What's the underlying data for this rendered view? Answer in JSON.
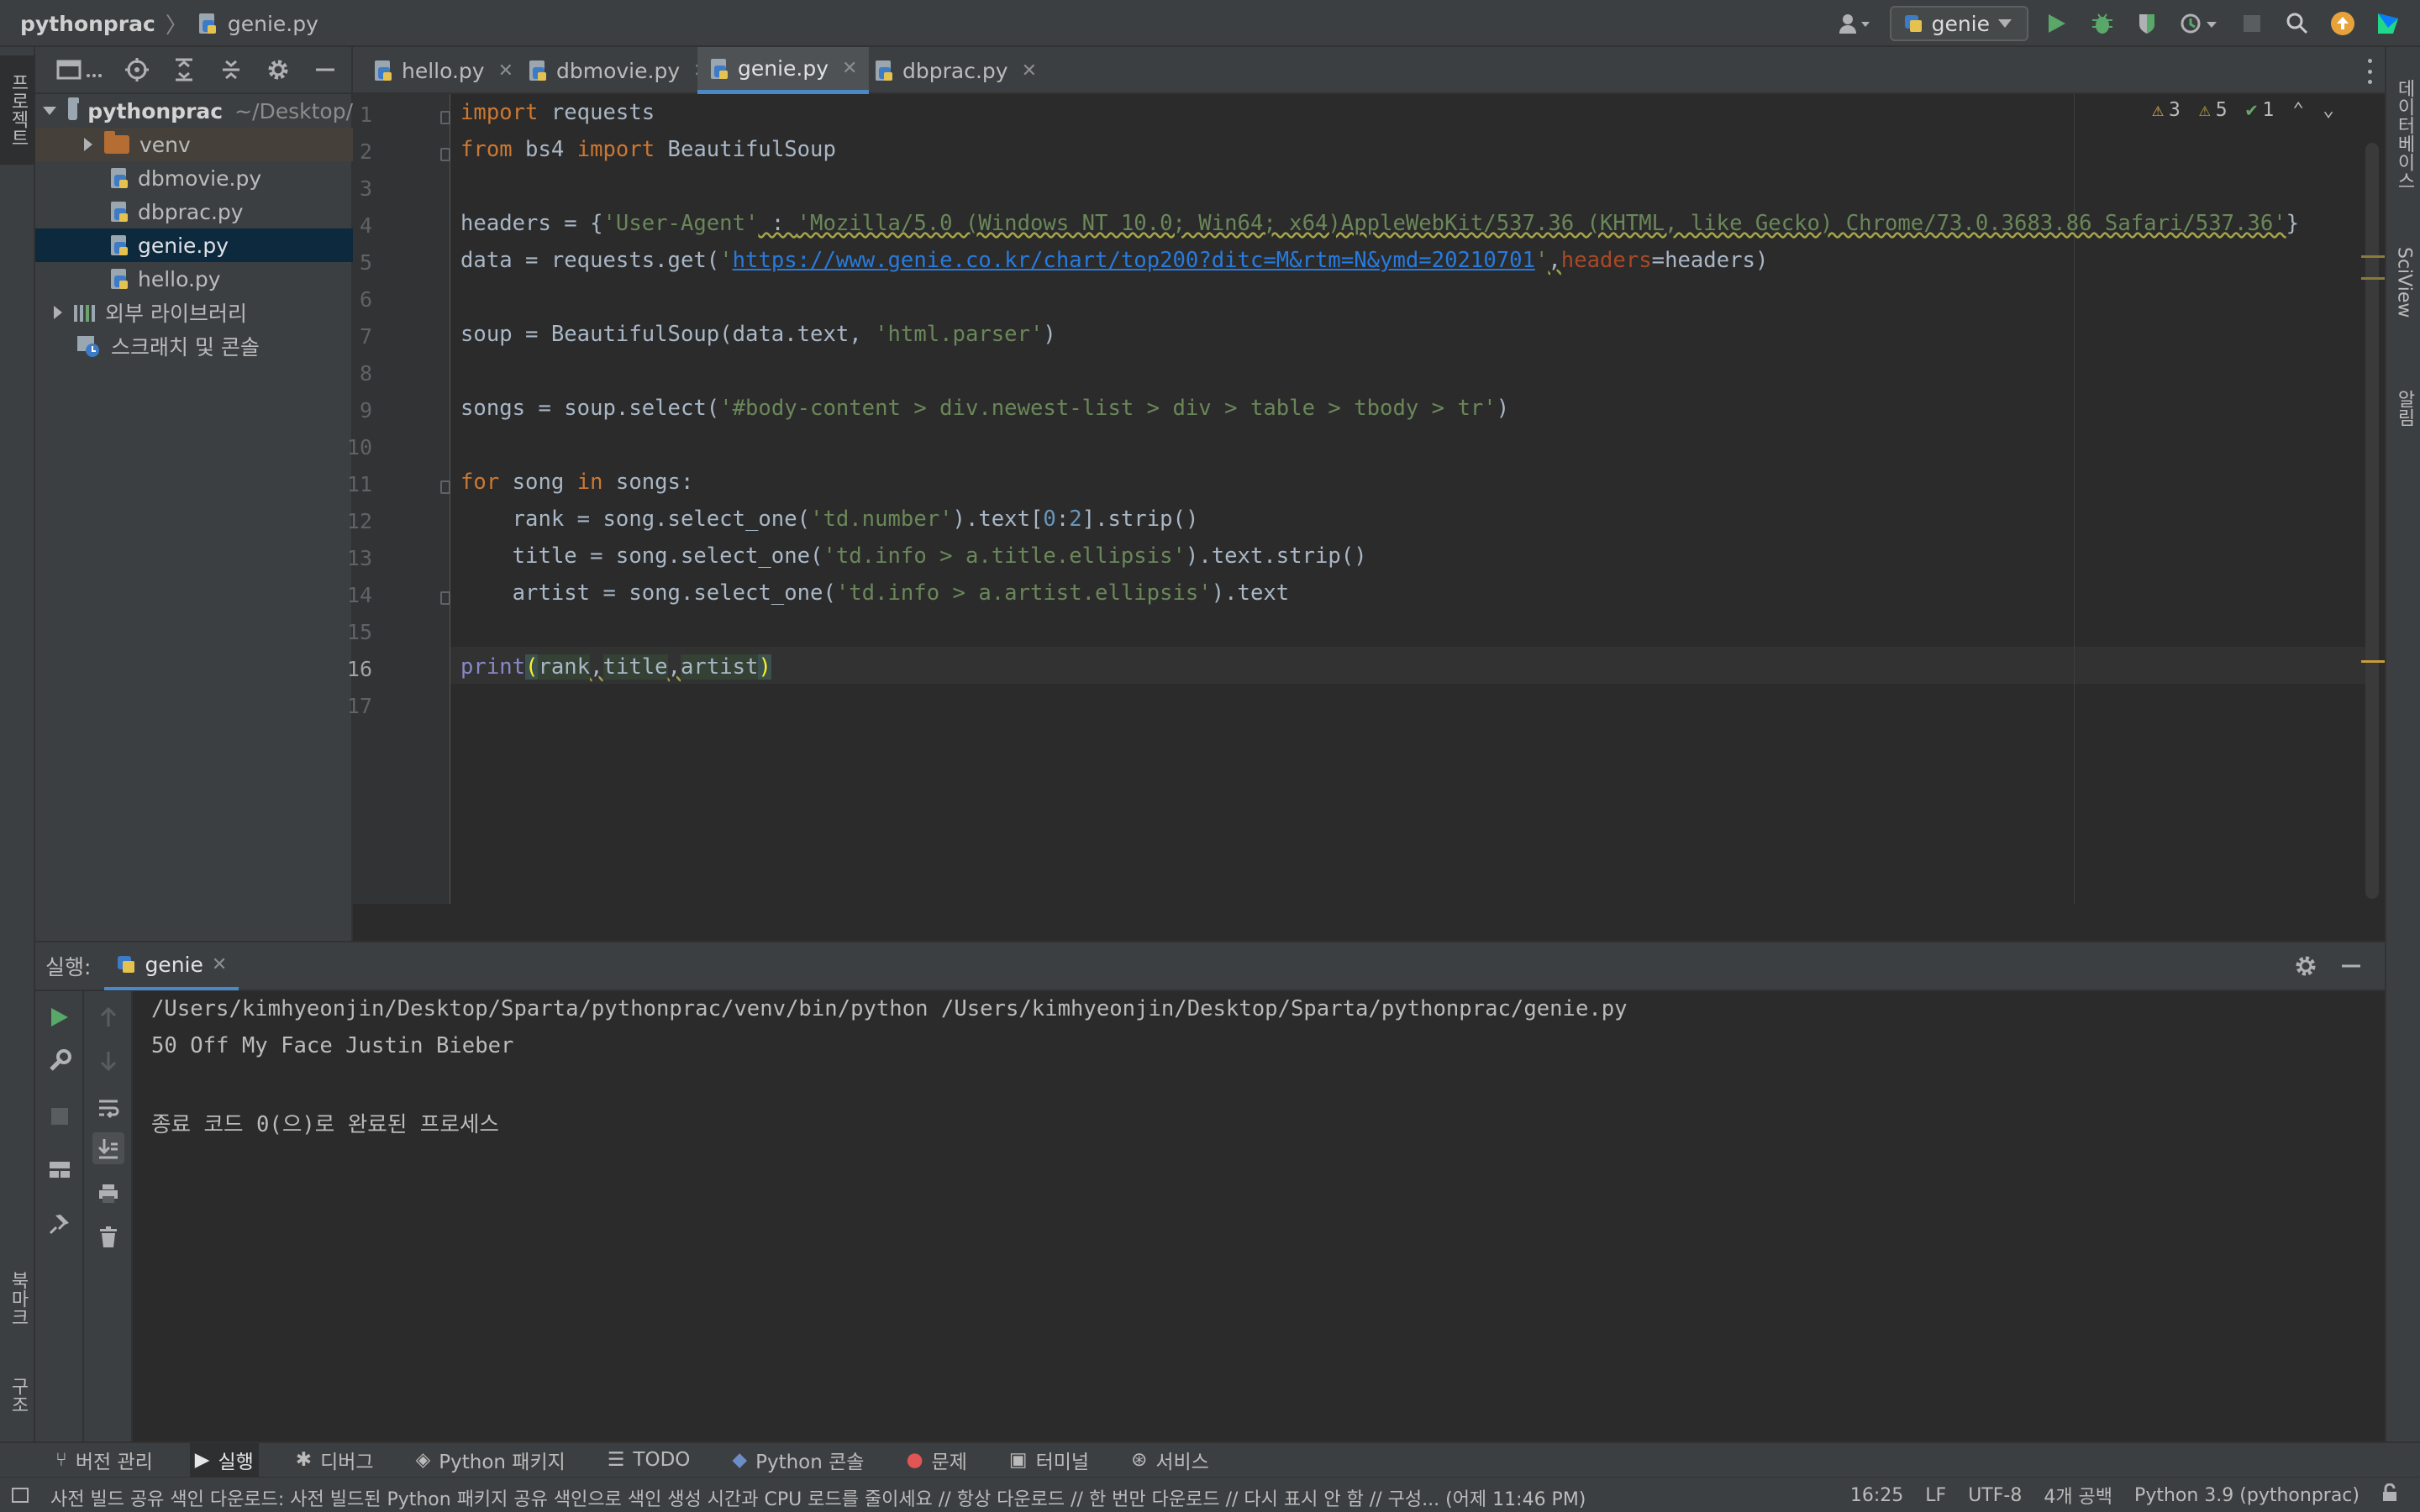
{
  "titlebar": {
    "project": "pythonprac",
    "file": "genie.py",
    "run_config": "genie"
  },
  "left_strip": {
    "project_tab": "프로젝트",
    "bookmarks_tab": "북마크",
    "structure_tab": "구조"
  },
  "right_strip": {
    "database_tab": "데이터베이스",
    "sciview_tab": "SciView",
    "notifications_tab": "알림"
  },
  "project_tree": {
    "root_name": "pythonprac",
    "root_path": "~/Desktop/",
    "items": [
      {
        "label": "venv"
      },
      {
        "label": "dbmovie.py"
      },
      {
        "label": "dbprac.py"
      },
      {
        "label": "genie.py"
      },
      {
        "label": "hello.py"
      },
      {
        "label": "외부 라이브러리"
      },
      {
        "label": "스크래치 및 콘솔"
      }
    ]
  },
  "tabs": [
    {
      "label": "hello.py"
    },
    {
      "label": "dbmovie.py"
    },
    {
      "label": "genie.py"
    },
    {
      "label": "dbprac.py"
    }
  ],
  "inspections": {
    "warnings_a": "3",
    "warnings_b": "5",
    "checks": "1"
  },
  "editor": {
    "line_numbers": [
      "1",
      "2",
      "3",
      "4",
      "5",
      "6",
      "7",
      "8",
      "9",
      "10",
      "11",
      "12",
      "13",
      "14",
      "15",
      "16",
      "17"
    ],
    "current_line": "16",
    "code": {
      "l1": [
        "import",
        " requests"
      ],
      "l2": [
        "from",
        " bs4 ",
        "import",
        " BeautifulSoup"
      ],
      "l4": [
        "headers = {",
        "'User-Agent'",
        " : ",
        "'Mozilla/5.0 (Windows NT 10.0; Win64; x64)AppleWebKit/537.36 (KHTML, like Gecko) Chrome/73.0.3683.86 Safari/537.36'",
        "}"
      ],
      "l5": [
        "data = requests.get(",
        "'",
        "https://www.genie.co.kr/chart/top200?ditc=M&rtm=N&ymd=20210701",
        "'",
        ",",
        "headers",
        "=headers)"
      ],
      "l7": [
        "soup = BeautifulSoup(data.text, ",
        "'html.parser'",
        ")"
      ],
      "l9": [
        "songs = soup.select(",
        "'#body-content > div.newest-list > div > table > tbody > tr'",
        ")"
      ],
      "l11": [
        "for",
        " song ",
        "in",
        " songs:"
      ],
      "l12": [
        "    rank = song.select_one(",
        "'td.number'",
        ").text[",
        "0",
        ":",
        "2",
        "].strip()"
      ],
      "l13": [
        "    title = song.select_one(",
        "'td.info > a.title.ellipsis'",
        ").text.strip()"
      ],
      "l14": [
        "    artist = song.select_one(",
        "'td.info > a.artist.ellipsis'",
        ").text"
      ],
      "l16": [
        "print",
        "(",
        "rank",
        ",",
        "title",
        ",",
        "artist",
        ")"
      ]
    }
  },
  "run": {
    "header_label": "실행:",
    "tab": "genie",
    "output": [
      "/Users/kimhyeonjin/Desktop/Sparta/pythonprac/venv/bin/python /Users/kimhyeonjin/Desktop/Sparta/pythonprac/genie.py",
      "50 Off My Face Justin Bieber",
      "",
      "종료 코드 0(으)로 완료된 프로세스"
    ]
  },
  "bottom_tabs": [
    {
      "label": "버전 관리",
      "icon": "branch-icon"
    },
    {
      "label": "실행",
      "icon": "play-icon"
    },
    {
      "label": "디버그",
      "icon": "bug-icon"
    },
    {
      "label": "Python 패키지",
      "icon": "package-icon"
    },
    {
      "label": "TODO",
      "icon": "list-icon"
    },
    {
      "label": "Python 콘솔",
      "icon": "python-icon"
    },
    {
      "label": "문제",
      "icon": "error-icon"
    },
    {
      "label": "터미널",
      "icon": "terminal-icon"
    },
    {
      "label": "서비스",
      "icon": "services-icon"
    }
  ],
  "status": {
    "message": "사전 빌드 공유 색인 다운로드: 사전 빌드된 Python 패키지 공유 색인으로 색인 생성 시간과 CPU 로드를 줄이세요 // 항상 다운로드 // 한 번만 다운로드 // 다시 표시 안 함 // 구성... (어제 11:46 PM)",
    "position": "16:25",
    "line_sep": "LF",
    "encoding": "UTF-8",
    "indent": "4개 공백",
    "interpreter": "Python 3.9 (pythonprac)"
  },
  "colors": {
    "keyword": "#cc7832",
    "string": "#6a8759",
    "number": "#6897bb",
    "accent": "#4a88c7",
    "selection": "#0d293e"
  }
}
